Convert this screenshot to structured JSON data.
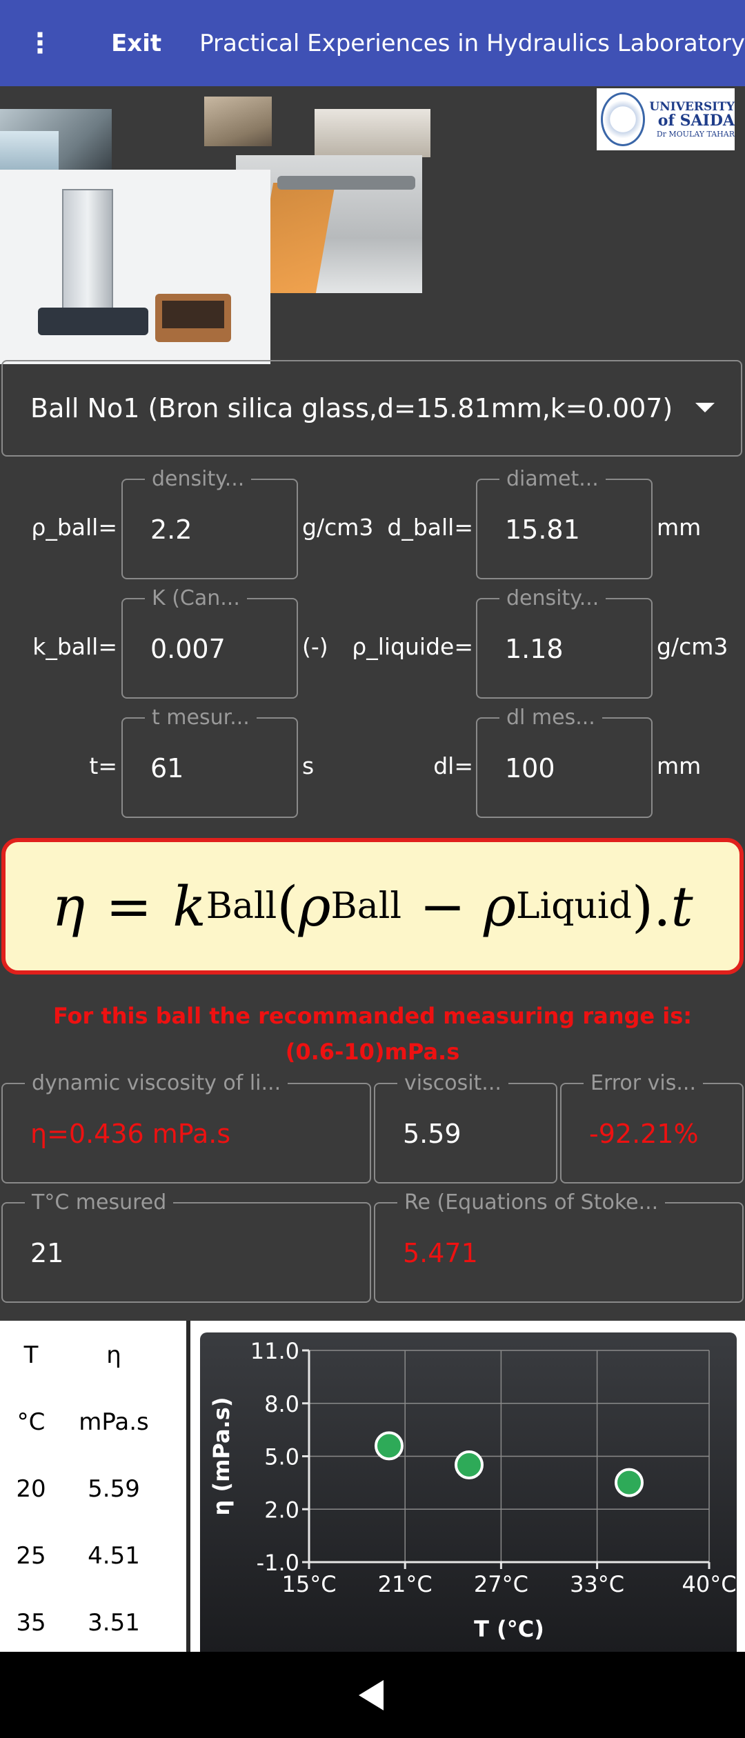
{
  "appbar": {
    "menu_icon": "more-vertical-icon",
    "exit_label": "Exit",
    "title": "Practical Experiences in Hydraulics Laboratory"
  },
  "logo": {
    "line1": "UNIVERSITY",
    "line2": "of SAIDA",
    "line3": "Dr MOULAY TAHAR"
  },
  "ball_select": {
    "selected": "Ball No1 (Bron silica glass,d=15.81mm,k=0.007)"
  },
  "inputs": {
    "rho_ball": {
      "label": "ρ_ball=",
      "legend": "density...",
      "value": "2.2",
      "unit": "g/cm3"
    },
    "d_ball": {
      "label": "d_ball=",
      "legend": "diamet...",
      "value": "15.81",
      "unit": "mm"
    },
    "k_ball": {
      "label": "k_ball=",
      "legend": "K (Can...",
      "value": "0.007",
      "unit": "(-)"
    },
    "rho_liquide": {
      "label": "ρ_liquide=",
      "legend": "density...",
      "value": "1.18",
      "unit": "g/cm3"
    },
    "t": {
      "label": "t=",
      "legend": "t mesur...",
      "value": "61",
      "unit": "s"
    },
    "dl": {
      "label": "dl=",
      "legend": "dl mes...",
      "value": "100",
      "unit": "mm"
    }
  },
  "formula": {
    "eta": "η",
    "equals": "=",
    "k": "k",
    "k_sub": "Ball",
    "rho1": "ρ",
    "rho1_sub": "Ball",
    "minus": "−",
    "rho2": "ρ",
    "rho2_sub": "Liquid",
    "t": "t"
  },
  "range_msg": {
    "line1": "For this ball the recommanded measuring range is:",
    "line2": "(0.6-10)mPa.s"
  },
  "results": {
    "dyn_visc": {
      "legend": "dynamic viscosity of li...",
      "value": "η=0.436 mPa.s"
    },
    "visc": {
      "legend": "viscosit...",
      "value": "5.59"
    },
    "error": {
      "legend": "Error vis...",
      "value": "-92.21%"
    },
    "temp": {
      "legend": "T°C mesured",
      "value": "21"
    },
    "re": {
      "legend": "Re (Equations of Stoke...",
      "value": "5.471"
    }
  },
  "table": {
    "header": [
      "T",
      "η"
    ],
    "units": [
      "°C",
      "mPa.s"
    ],
    "rows": [
      [
        "20",
        "5.59"
      ],
      [
        "25",
        "4.51"
      ],
      [
        "35",
        "3.51"
      ]
    ]
  },
  "colors": {
    "appbar": "#3f51b5",
    "background": "#3a3a3a",
    "error_red": "#ee1111",
    "formula_bg": "#fdf6c9",
    "formula_border": "#e0201c",
    "point": "#2eaa58"
  },
  "chart_data": {
    "type": "scatter",
    "xlabel": "T (°C)",
    "ylabel": "η (mPa.s)",
    "xlim": [
      15,
      40
    ],
    "ylim": [
      -1.0,
      11.0
    ],
    "x_ticks": [
      "15°C",
      "21°C",
      "27°C",
      "33°C",
      "40°C"
    ],
    "x_tick_values": [
      15,
      21,
      27,
      33,
      40
    ],
    "y_ticks": [
      "-1.0",
      "2.0",
      "5.0",
      "8.0",
      "11.0"
    ],
    "y_tick_values": [
      -1,
      2,
      5,
      8,
      11
    ],
    "grid": true,
    "series": [
      {
        "points": [
          [
            20,
            5.59
          ],
          [
            25,
            4.51
          ],
          [
            35,
            3.51
          ]
        ]
      }
    ]
  }
}
